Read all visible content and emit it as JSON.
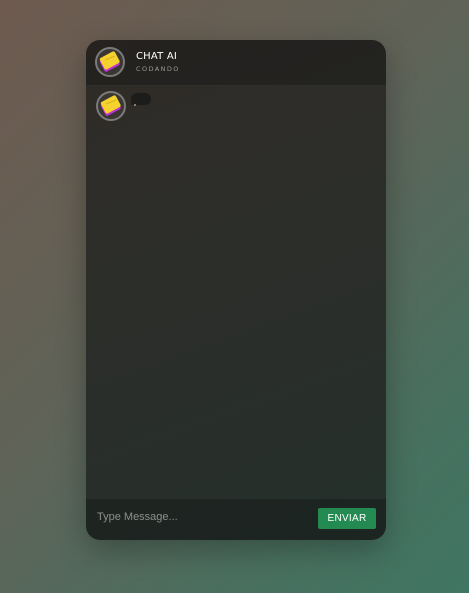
{
  "header": {
    "title": "CHAT AI",
    "status": "CODANDO",
    "avatar_icon": "sticky-note-icon"
  },
  "messages": [
    {
      "sender": "bot",
      "avatar_icon": "sticky-note-icon",
      "state": "typing"
    }
  ],
  "composer": {
    "placeholder": "Type Message...",
    "value": "",
    "send_label": "ENVIAR"
  },
  "colors": {
    "send_button": "#238b52",
    "avatar_note": "#f5d22e",
    "avatar_accent": "#c430d6"
  }
}
